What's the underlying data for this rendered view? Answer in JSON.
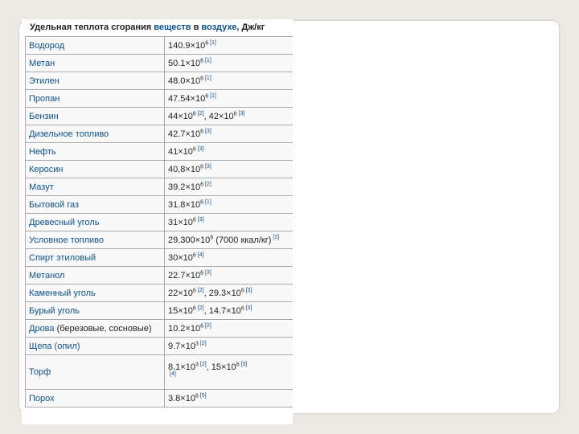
{
  "caption": {
    "text1": "Удельная теплота сгорания",
    "link1": "веществ",
    "text2": "в",
    "link2": "воздухе",
    "text3": ", Дж/кг"
  },
  "rows": [
    {
      "name": "Водород",
      "v1": "140.9×10",
      "e1": "6",
      "r1": "[1]"
    },
    {
      "name": "Метан",
      "v1": "50.1×10",
      "e1": "6",
      "r1": "[1]"
    },
    {
      "name": "Этилен",
      "v1": "48.0×10",
      "e1": "6",
      "r1": "[1]"
    },
    {
      "name": "Пропан",
      "v1": "47.54×10",
      "e1": "6",
      "r1": "[1]"
    },
    {
      "name": "Бензин",
      "v1": "44×10",
      "e1": "6",
      "r1": "[2]",
      "sep": ", ",
      "v2": "42×10",
      "e2": "6",
      "r2": "[3]"
    },
    {
      "name": "Дизельное топливо",
      "v1": "42.7×10",
      "e1": "6",
      "r1": "[3]"
    },
    {
      "name": "Нефть",
      "v1": "41×10",
      "e1": "6",
      "r1": "[3]"
    },
    {
      "name": "Керосин",
      "v1": "40,8×10",
      "e1": "6",
      "r1": "[3]"
    },
    {
      "name": "Мазут",
      "v1": "39.2×10",
      "e1": "6",
      "r1": "[2]"
    },
    {
      "name": "Бытовой газ",
      "v1": "31.8×10",
      "e1": "6",
      "r1": "[1]"
    },
    {
      "name": "Древесный уголь",
      "v1": "31×10",
      "e1": "6",
      "r1": "[3]"
    },
    {
      "name": "Условное топливо",
      "v1": "29.300×10",
      "e1": "6",
      "v2": " (7000 ккал/кг)",
      "r2": "[2]"
    },
    {
      "name": "Спирт этиловый",
      "v1": "30×10",
      "e1": "6",
      "r1": "[4]"
    },
    {
      "name": "Метанол",
      "v1": "22.7×10",
      "e1": "6",
      "r1": "[3]"
    },
    {
      "name": "Каменный уголь",
      "v1": "22×10",
      "e1": "6",
      "r1": "[2]",
      "sep": ", ",
      "v2": "29.3×10",
      "e2": "6",
      "r2": "[3]"
    },
    {
      "name": "Бурый уголь",
      "v1": "15×10",
      "e1": "6",
      "r1": "[2]",
      "sep": ", ",
      "v2": "14.7×10",
      "e2": "6",
      "r2": "[3]"
    },
    {
      "name": "Дрова",
      "name_extra": " (березовые, сосновые)",
      "v1": "10.2×10",
      "e1": "6",
      "r1": "[2]"
    },
    {
      "name": "Щепа (опил)",
      "v1": "9.7×10",
      "e1": "3",
      "r1": "[2]"
    },
    {
      "name": "Торф",
      "tall": true,
      "v1": "8.1×10",
      "e1": "3",
      "r1": "[2]",
      "sep": ", ",
      "v2": "15×10",
      "e2": "6",
      "r2": "[3]",
      "r3": "[4]"
    },
    {
      "name": "Порох",
      "v1": "3.8×10",
      "e1": "6",
      "r1": "[5]"
    }
  ]
}
